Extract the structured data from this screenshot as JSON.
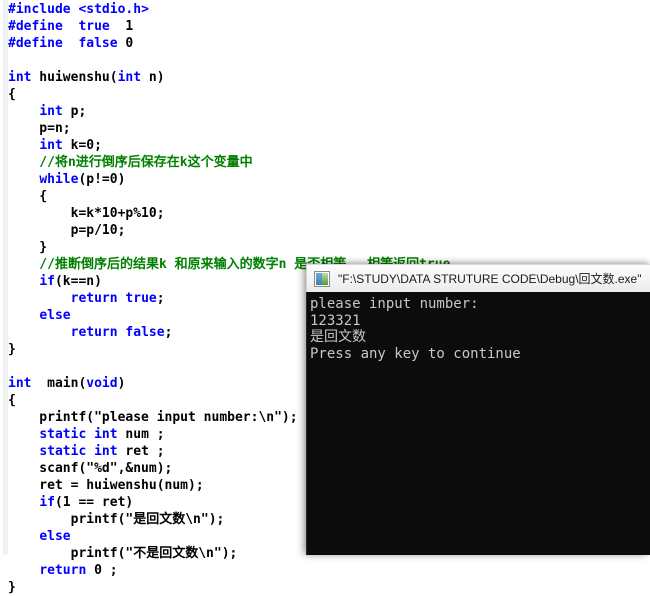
{
  "editor": {
    "name": "source-code-editor",
    "language": "c",
    "colors": {
      "background": "#ffffff",
      "text": "#000000",
      "keyword": "#0000ff",
      "preprocessor": "#0000ff",
      "comment": "#008000",
      "gutter": "#f2f2f2"
    },
    "code_lines": [
      [
        {
          "t": "#include ",
          "c": "pp"
        },
        {
          "t": "<stdio.h>",
          "c": "pp"
        }
      ],
      [
        {
          "t": "#define",
          "c": "pp"
        },
        {
          "t": "  ",
          "c": "pl"
        },
        {
          "t": "true",
          "c": "pp"
        },
        {
          "t": "  1",
          "c": "pl"
        }
      ],
      [
        {
          "t": "#define",
          "c": "pp"
        },
        {
          "t": "  ",
          "c": "pl"
        },
        {
          "t": "false",
          "c": "pp"
        },
        {
          "t": " 0",
          "c": "pl"
        }
      ],
      [],
      [
        {
          "t": "int",
          "c": "kw"
        },
        {
          "t": " huiwenshu(",
          "c": "pl"
        },
        {
          "t": "int",
          "c": "kw"
        },
        {
          "t": " n)",
          "c": "pl"
        }
      ],
      [
        {
          "t": "{",
          "c": "pl"
        }
      ],
      [
        {
          "t": "    ",
          "c": "pl"
        },
        {
          "t": "int",
          "c": "kw"
        },
        {
          "t": " p;",
          "c": "pl"
        }
      ],
      [
        {
          "t": "    p=n;",
          "c": "pl"
        }
      ],
      [
        {
          "t": "    ",
          "c": "pl"
        },
        {
          "t": "int",
          "c": "kw"
        },
        {
          "t": " k=0;",
          "c": "pl"
        }
      ],
      [
        {
          "t": "    //将n进行倒序后保存在k这个变量中",
          "c": "cm"
        }
      ],
      [
        {
          "t": "    ",
          "c": "pl"
        },
        {
          "t": "while",
          "c": "kw"
        },
        {
          "t": "(p!=0)",
          "c": "pl"
        }
      ],
      [
        {
          "t": "    {",
          "c": "pl"
        }
      ],
      [
        {
          "t": "        k=k*10+p%10;",
          "c": "pl"
        }
      ],
      [
        {
          "t": "        p=p/10;",
          "c": "pl"
        }
      ],
      [
        {
          "t": "    }",
          "c": "pl"
        }
      ],
      [
        {
          "t": "    //推断倒序后的结果k 和原来输入的数字n 是否相等， 相等返回",
          "c": "cm"
        },
        {
          "t": "true",
          "c": "cm"
        }
      ],
      [
        {
          "t": "    ",
          "c": "pl"
        },
        {
          "t": "if",
          "c": "kw"
        },
        {
          "t": "(k==n)",
          "c": "pl"
        }
      ],
      [
        {
          "t": "        ",
          "c": "pl"
        },
        {
          "t": "return",
          "c": "kw"
        },
        {
          "t": " ",
          "c": "pl"
        },
        {
          "t": "true",
          "c": "kw"
        },
        {
          "t": ";",
          "c": "pl"
        }
      ],
      [
        {
          "t": "    ",
          "c": "pl"
        },
        {
          "t": "else",
          "c": "kw"
        }
      ],
      [
        {
          "t": "        ",
          "c": "pl"
        },
        {
          "t": "return",
          "c": "kw"
        },
        {
          "t": " ",
          "c": "pl"
        },
        {
          "t": "false",
          "c": "kw"
        },
        {
          "t": ";",
          "c": "pl"
        }
      ],
      [
        {
          "t": "}",
          "c": "pl"
        }
      ],
      [],
      [
        {
          "t": "int",
          "c": "kw"
        },
        {
          "t": "  main(",
          "c": "pl"
        },
        {
          "t": "void",
          "c": "kw"
        },
        {
          "t": ")",
          "c": "pl"
        }
      ],
      [
        {
          "t": "{",
          "c": "pl"
        }
      ],
      [
        {
          "t": "    printf(\"please input number:\\n\");",
          "c": "pl"
        }
      ],
      [
        {
          "t": "    ",
          "c": "pl"
        },
        {
          "t": "static",
          "c": "kw"
        },
        {
          "t": " ",
          "c": "pl"
        },
        {
          "t": "int",
          "c": "kw"
        },
        {
          "t": " num ;",
          "c": "pl"
        }
      ],
      [
        {
          "t": "    ",
          "c": "pl"
        },
        {
          "t": "static",
          "c": "kw"
        },
        {
          "t": " ",
          "c": "pl"
        },
        {
          "t": "int",
          "c": "kw"
        },
        {
          "t": " ret ;",
          "c": "pl"
        }
      ],
      [
        {
          "t": "    scanf(\"%d\",&num);",
          "c": "pl"
        }
      ],
      [
        {
          "t": "    ret = huiwenshu(num);",
          "c": "pl"
        }
      ],
      [
        {
          "t": "    ",
          "c": "pl"
        },
        {
          "t": "if",
          "c": "kw"
        },
        {
          "t": "(1 == ret)",
          "c": "pl"
        }
      ],
      [
        {
          "t": "        printf(\"是回文数\\n\");",
          "c": "pl"
        }
      ],
      [
        {
          "t": "    ",
          "c": "pl"
        },
        {
          "t": "else",
          "c": "kw"
        }
      ],
      [
        {
          "t": "        printf(\"不是回文数\\n\");",
          "c": "pl"
        }
      ],
      [
        {
          "t": "    ",
          "c": "pl"
        },
        {
          "t": "return",
          "c": "kw"
        },
        {
          "t": " 0 ;",
          "c": "pl"
        }
      ],
      [
        {
          "t": "}",
          "c": "pl"
        }
      ]
    ]
  },
  "console": {
    "name": "program-output-console",
    "title": "\"F:\\STUDY\\DATA STRUTURE CODE\\Debug\\回文数.exe\"",
    "icon": "console-app-icon",
    "background": "#0c0c0c",
    "foreground": "#c8c8c8",
    "output_lines": [
      "please input number:",
      "123321",
      "是回文数",
      "Press any key to continue"
    ]
  }
}
